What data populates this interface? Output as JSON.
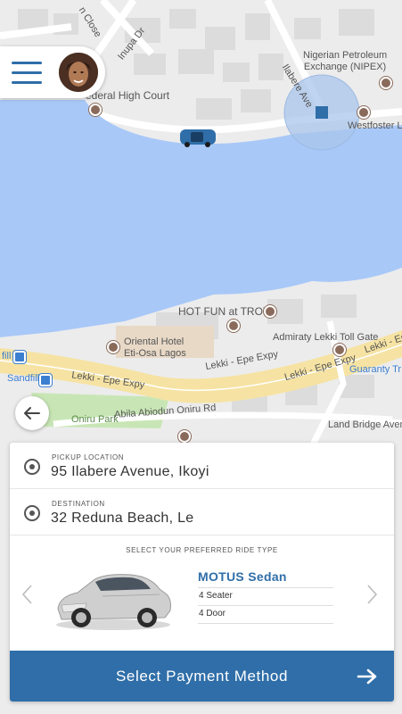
{
  "map": {
    "labels": {
      "street_ilabere": "Ilabere Ave",
      "street_inupa": "Inupa Dr",
      "street_close": "n Close",
      "federal_high_court": "ederal High Court",
      "nipex": "Nigerian Petroleum\nExchange (NIPEX)",
      "westfoster": "Westfoster L",
      "hot_fun": "HOT FUN at TROY",
      "admiraty": "Admiraty Lekki Toll Gate",
      "oriental_hotel": "Oriental Hotel\nEti-Osa Lagos",
      "lekki_epe_1": "Lekki - Epe Expy",
      "lekki_epe_2": "Lekki - Epe Expy",
      "lekki_epe_3": "Lekki - Epe Expy",
      "lekki_epe_4": "Lekki - Epe",
      "guaranty": "Guaranty Tr",
      "sandfill_1": "fill",
      "sandfill_2": "Sandfill",
      "oniru_park": "Oniru Park",
      "abila": "Abila Abiodun Oniru Rd",
      "land_bridge": "Land Bridge Avenue"
    },
    "colors": {
      "water": "#a8c8f8",
      "land": "#ececec",
      "road": "#ffffff",
      "highway": "#f6e3a3",
      "park": "#c8e6b5",
      "accent": "#2f6ea8"
    }
  },
  "header": {
    "menu_icon": "hamburger-menu-icon",
    "avatar_icon": "user-avatar"
  },
  "navigation": {
    "back_icon": "arrow-left-icon"
  },
  "booking": {
    "pickup": {
      "label": "PICKUP LOCATION",
      "value": "95 Ilabere Avenue, Ikoyi"
    },
    "destination": {
      "label": "DESTINATION",
      "value": "32 Reduna Beach, Le"
    },
    "ride": {
      "title": "SELECT YOUR PREFERRED RIDE TYPE",
      "name": "MOTUS Sedan",
      "seats": "4 Seater",
      "doors": "4 Door"
    },
    "payment_button": "Select Payment Method"
  }
}
